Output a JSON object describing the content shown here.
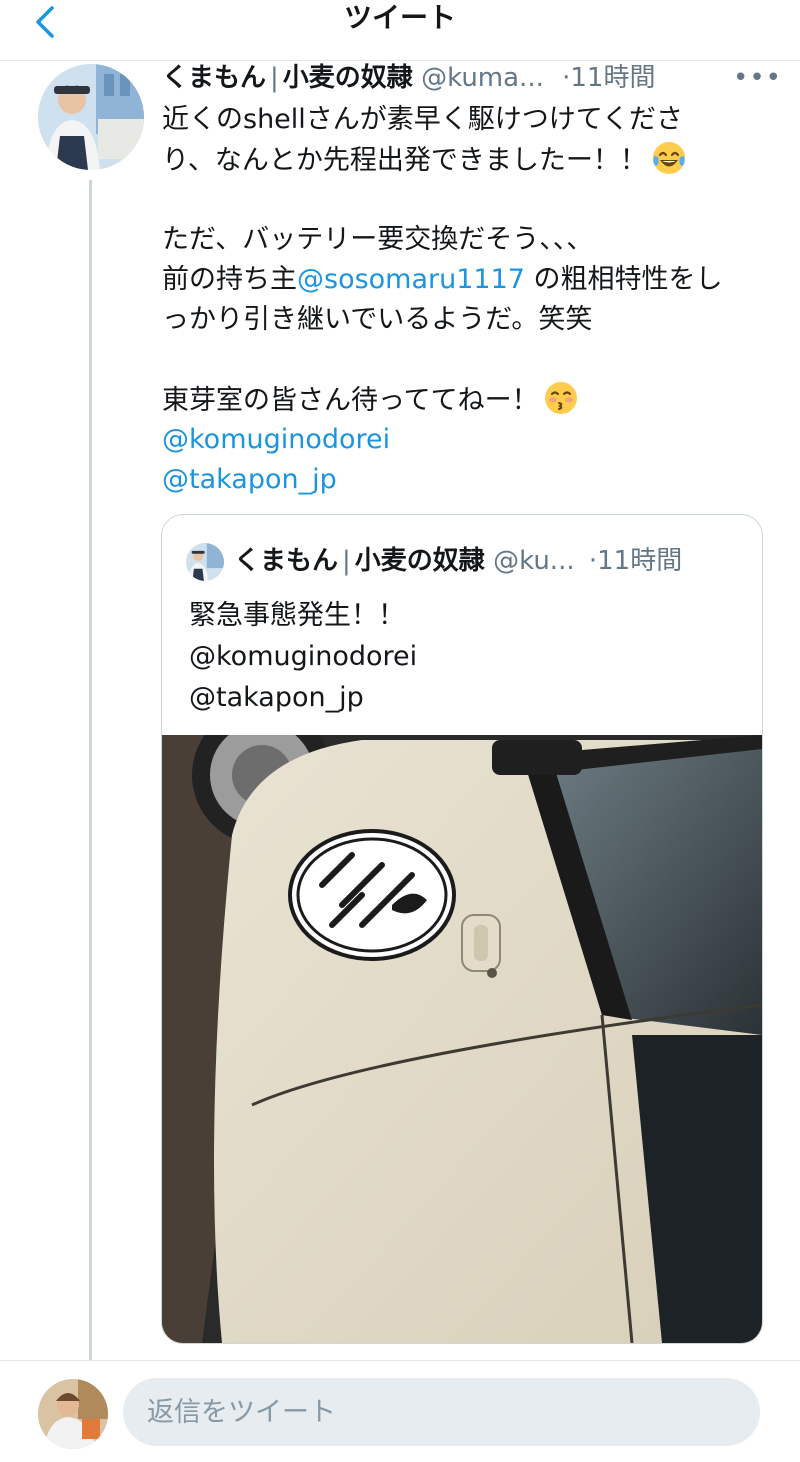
{
  "header": {
    "title": "ツイート"
  },
  "tweet": {
    "display_name": "くまもん",
    "separator": "|",
    "display_name_suffix": "小麦の奴隷",
    "handle": "@kuma...",
    "dot": "·",
    "time": "11時間",
    "more_label": "•••",
    "lines": [
      "近くのshellさんが素早く駆けつけてくださ",
      "り、なんとか先程出発できましたー！！",
      "ただ、バッテリー要交換だそう、、、",
      "前の持ち主",
      "@sosomaru1117",
      " の粗相特性をし",
      "っかり引き継いでいるようだ。笑笑",
      "東芽室の皆さん待っててねー！"
    ],
    "mentions": [
      "@komuginodorei",
      "@takapon_jp"
    ],
    "emojis": [
      "laughing-tears",
      "kissing-face"
    ]
  },
  "quote": {
    "display_name": "くまもん",
    "separator": "|",
    "display_name_suffix": "小麦の奴隷",
    "handle": "@ku...",
    "dot": "·",
    "time": "11時間",
    "lines": [
      "緊急事態発生！！",
      "@komuginodorei",
      "@takapon_jp"
    ],
    "media": "photo of a cream-colored kei truck door with a circular logo sticker"
  },
  "reply": {
    "placeholder": "返信をツイート"
  },
  "colors": {
    "link": "#1b95e0",
    "secondary_text": "#657786",
    "border": "#e1e8ed",
    "reply_field_bg": "#e6ecf0"
  }
}
